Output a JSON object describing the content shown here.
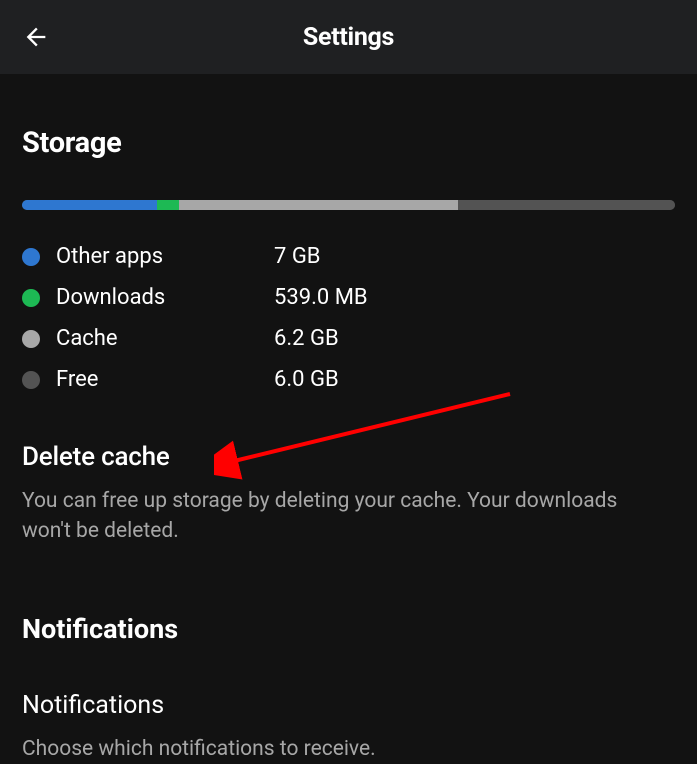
{
  "header": {
    "title": "Settings"
  },
  "storage": {
    "heading": "Storage",
    "segments": [
      {
        "key": "other",
        "color": "#2e77d0",
        "pct": 20.6
      },
      {
        "key": "downloads",
        "color": "#1db954",
        "pct": 3.4
      },
      {
        "key": "cache",
        "color": "#a7a7a7",
        "pct": 42.7
      },
      {
        "key": "free",
        "color": "#535353",
        "pct": 33.3
      }
    ],
    "rows": [
      {
        "label": "Other apps",
        "value": "7 GB",
        "color": "#2e77d0"
      },
      {
        "label": "Downloads",
        "value": "539.0 MB",
        "color": "#1db954"
      },
      {
        "label": "Cache",
        "value": "6.2 GB",
        "color": "#a7a7a7"
      },
      {
        "label": "Free",
        "value": "6.0 GB",
        "color": "#535353"
      }
    ],
    "deleteCache": {
      "title": "Delete cache",
      "desc": "You can free up storage by deleting your cache. Your downloads won't be deleted."
    }
  },
  "notifications": {
    "heading": "Notifications",
    "item": {
      "title": "Notifications",
      "desc": "Choose which notifications to receive."
    }
  }
}
